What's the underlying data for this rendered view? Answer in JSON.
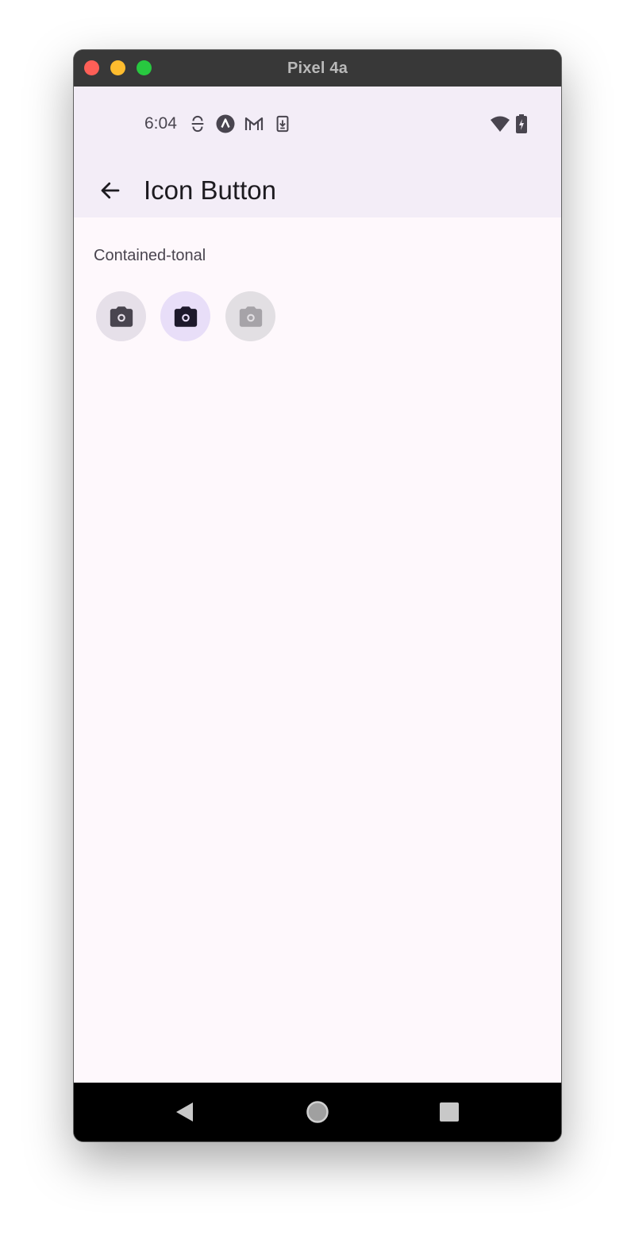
{
  "window": {
    "title": "Pixel 4a"
  },
  "status_bar": {
    "time": "6:04",
    "icons": [
      "sync-icon",
      "app-a-icon",
      "gmail-icon",
      "download-icon",
      "wifi-icon",
      "battery-charging-icon"
    ]
  },
  "app_bar": {
    "title": "Icon Button",
    "back_icon": "arrow-back-icon"
  },
  "main": {
    "section_label": "Contained-tonal",
    "buttons": [
      {
        "icon": "camera-icon",
        "state": "default",
        "bg": "#e6e0e9",
        "fg": "#49454f"
      },
      {
        "icon": "camera-icon",
        "state": "selected",
        "bg": "#e8def8",
        "fg": "#1d192b"
      },
      {
        "icon": "camera-icon",
        "state": "disabled",
        "bg": "#e2dfe3",
        "fg": "#a6a3a8"
      }
    ]
  },
  "nav_bar": {
    "buttons": [
      "back-triangle-icon",
      "home-circle-icon",
      "recents-square-icon"
    ]
  },
  "colors": {
    "titlebar": "#383838",
    "appbar": "#f3edf7",
    "surface": "#fef8fc",
    "navbar": "#000000"
  }
}
